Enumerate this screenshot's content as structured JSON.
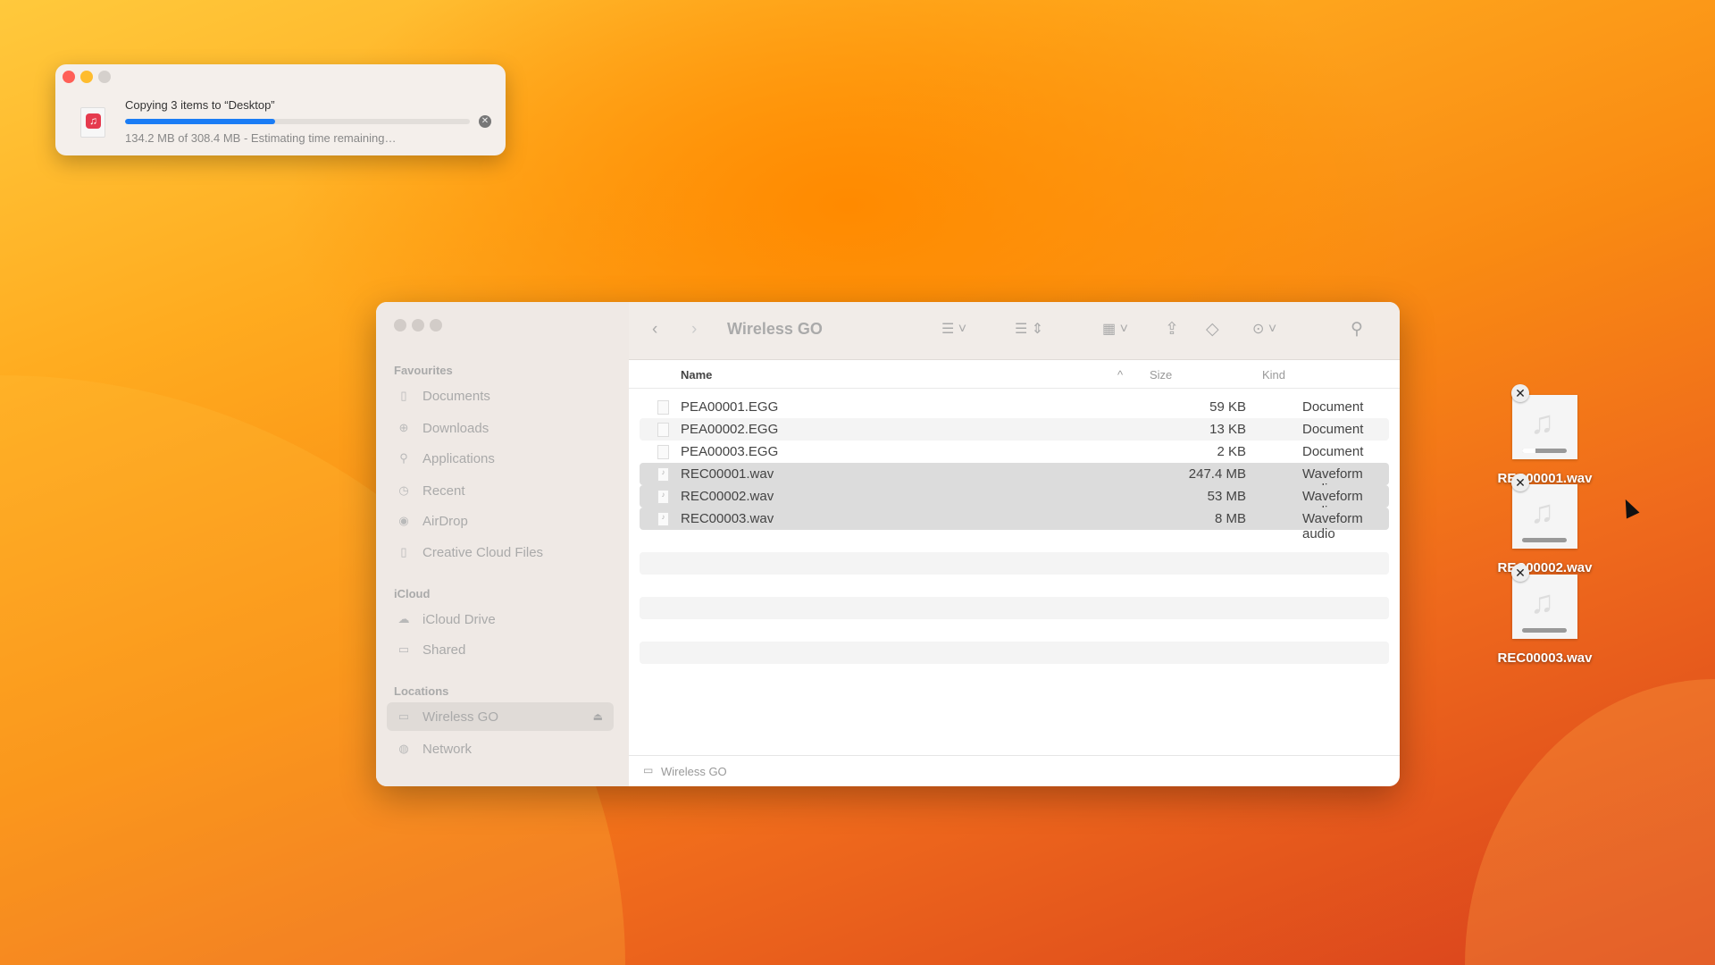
{
  "copy_dialog": {
    "title": "Copying 3 items to “Desktop”",
    "status": "134.2 MB of 308.4 MB - Estimating time remaining…",
    "progress_fraction": 0.435,
    "progress_color": "#1a7cf5",
    "file_icon": "music-file-icon"
  },
  "finder": {
    "title": "Wireless GO",
    "sidebar": {
      "favourites_label": "Favourites",
      "favourites": [
        {
          "label": "Documents",
          "icon": "document-icon"
        },
        {
          "label": "Downloads",
          "icon": "download-icon"
        },
        {
          "label": "Applications",
          "icon": "applications-icon"
        },
        {
          "label": "Recent",
          "icon": "clock-icon"
        },
        {
          "label": "AirDrop",
          "icon": "airdrop-icon"
        },
        {
          "label": "Creative Cloud Files",
          "icon": "document-icon"
        }
      ],
      "icloud_label": "iCloud",
      "icloud": [
        {
          "label": "iCloud Drive",
          "icon": "cloud-icon"
        },
        {
          "label": "Shared",
          "icon": "shared-folder-icon"
        }
      ],
      "locations_label": "Locations",
      "locations": [
        {
          "label": "Wireless GO",
          "icon": "drive-icon",
          "selected": true
        },
        {
          "label": "Network",
          "icon": "globe-icon"
        }
      ]
    },
    "columns": {
      "name": "Name",
      "size": "Size",
      "kind": "Kind"
    },
    "files": [
      {
        "name": "PEA00001.EGG",
        "size": "59 KB",
        "kind": "Document",
        "selected": false
      },
      {
        "name": "PEA00002.EGG",
        "size": "13 KB",
        "kind": "Document",
        "selected": false
      },
      {
        "name": "PEA00003.EGG",
        "size": "2 KB",
        "kind": "Document",
        "selected": false
      },
      {
        "name": "REC00001.wav",
        "size": "247.4 MB",
        "kind": "Waveform audio",
        "selected": true
      },
      {
        "name": "REC00002.wav",
        "size": "53 MB",
        "kind": "Waveform audio",
        "selected": true
      },
      {
        "name": "REC00003.wav",
        "size": "8 MB",
        "kind": "Waveform audio",
        "selected": true
      }
    ],
    "path_bar": "Wireless GO"
  },
  "desktop": {
    "items": [
      {
        "name": "REC00001.wav",
        "progress_fraction": 0.3
      },
      {
        "name": "REC00002.wav",
        "progress_fraction": 0
      },
      {
        "name": "REC00003.wav",
        "progress_fraction": 0
      }
    ]
  }
}
